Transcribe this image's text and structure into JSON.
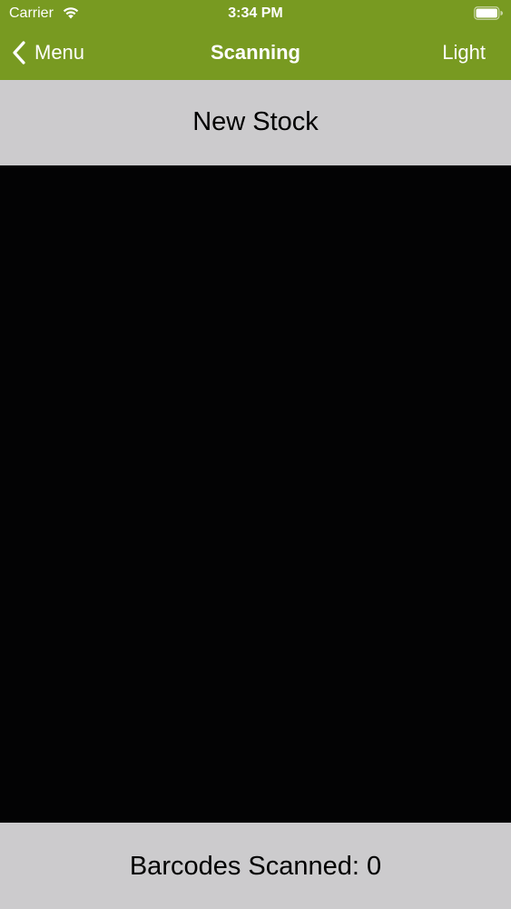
{
  "status_bar": {
    "carrier": "Carrier",
    "time": "3:34 PM",
    "wifi_icon": "wifi-icon",
    "battery_icon": "battery-icon"
  },
  "nav": {
    "back_label": "Menu",
    "back_icon": "chevron-left-icon",
    "title": "Scanning",
    "right_label": "Light"
  },
  "header": {
    "title": "New Stock"
  },
  "footer": {
    "scanned_text": "Barcodes Scanned: 0"
  },
  "colors": {
    "nav_background": "#789a21",
    "panel_background": "#cccbcd",
    "camera_background": "#030304"
  }
}
